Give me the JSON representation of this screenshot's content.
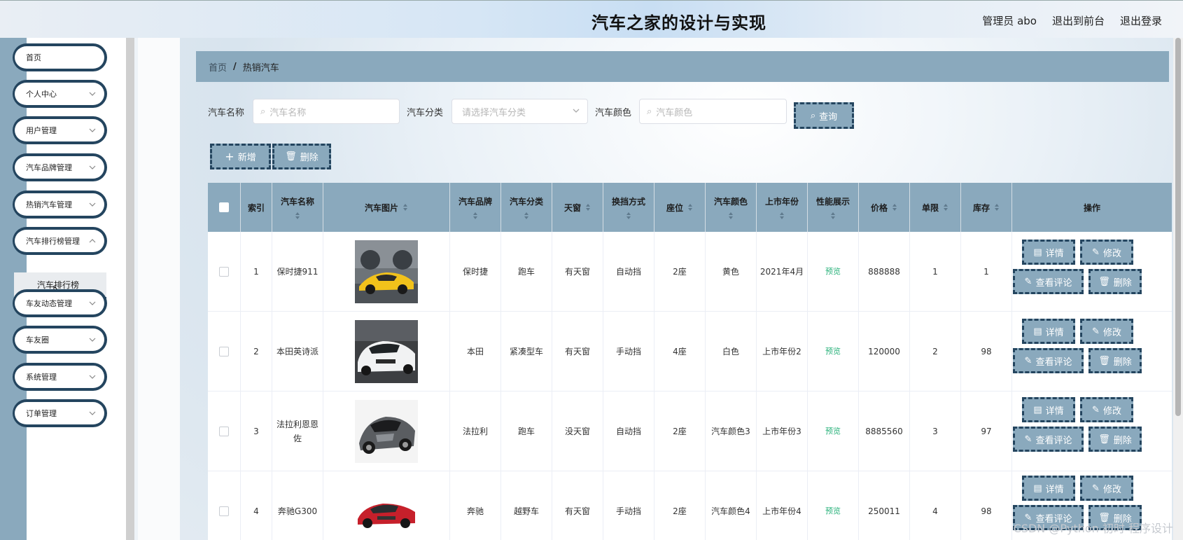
{
  "header": {
    "title": "汽车之家的设计与实现",
    "admin_label": "管理员 abo",
    "back_label": "退出到前台",
    "logout_label": "退出登录"
  },
  "sidebar": {
    "items": [
      {
        "label": "首页",
        "has_children": false
      },
      {
        "label": "个人中心",
        "has_children": true
      },
      {
        "label": "用户管理",
        "has_children": true
      },
      {
        "label": "汽车品牌管理",
        "has_children": true
      },
      {
        "label": "热销汽车管理",
        "has_children": true
      },
      {
        "label": "汽车排行榜管理",
        "has_children": true,
        "expanded": true
      },
      {
        "label": "车友动态管理",
        "has_children": true
      },
      {
        "label": "车友圈",
        "has_children": true
      },
      {
        "label": "系统管理",
        "has_children": true
      },
      {
        "label": "订单管理",
        "has_children": true
      }
    ],
    "submenu_label": "汽车排行榜"
  },
  "breadcrumb": {
    "home": "首页",
    "separator": "/",
    "current": "热销汽车"
  },
  "search": {
    "name_label": "汽车名称",
    "name_placeholder": "汽车名称",
    "category_label": "汽车分类",
    "category_placeholder": "请选择汽车分类",
    "color_label": "汽车颜色",
    "color_placeholder": "汽车颜色",
    "query_label": "查询"
  },
  "actions": {
    "add_label": "新增",
    "delete_label": "删除"
  },
  "table": {
    "columns": [
      "索引",
      "汽车名称",
      "汽车图片",
      "汽车品牌",
      "汽车分类",
      "天窗",
      "换挡方式",
      "座位",
      "汽车颜色",
      "上市年份",
      "性能展示",
      "价格",
      "单限",
      "库存",
      "操作"
    ],
    "rows": [
      {
        "index": "1",
        "name": "保时捷911",
        "brand": "保时捷",
        "category": "跑车",
        "sunroof": "有天窗",
        "gear": "自动挡",
        "seats": "2座",
        "color": "黄色",
        "year": "2021年4月",
        "perf": "预览",
        "price": "888888",
        "limit": "1",
        "stock": "1",
        "image": "yellow-sports-car"
      },
      {
        "index": "2",
        "name": "本田英诗派",
        "brand": "本田",
        "category": "紧凑型车",
        "sunroof": "有天窗",
        "gear": "手动挡",
        "seats": "4座",
        "color": "白色",
        "year": "上市年份2",
        "perf": "预览",
        "price": "120000",
        "limit": "2",
        "stock": "98",
        "image": "white-sedan"
      },
      {
        "index": "3",
        "name": "法拉利恩恩佐",
        "brand": "法拉利",
        "category": "跑车",
        "sunroof": "没天窗",
        "gear": "自动挡",
        "seats": "2座",
        "color": "汽车颜色3",
        "year": "上市年份3",
        "perf": "预览",
        "price": "8885560",
        "limit": "3",
        "stock": "97",
        "image": "grey-supercar"
      },
      {
        "index": "4",
        "name": "奔驰G300",
        "brand": "奔驰",
        "category": "越野车",
        "sunroof": "有天窗",
        "gear": "手动挡",
        "seats": "2座",
        "color": "汽车颜色4",
        "year": "上市年份4",
        "perf": "预览",
        "price": "250011",
        "limit": "4",
        "stock": "98",
        "image": "red-sedan"
      }
    ],
    "row_actions": {
      "detail": "详情",
      "edit": "修改",
      "comments": "查看评论",
      "delete": "删除"
    }
  },
  "watermark": "CSDN @Python 初时 程序设计",
  "colors": {
    "accent": "#8aa9bd",
    "accent_dark": "#24455f",
    "link_green": "#2ab27b"
  }
}
